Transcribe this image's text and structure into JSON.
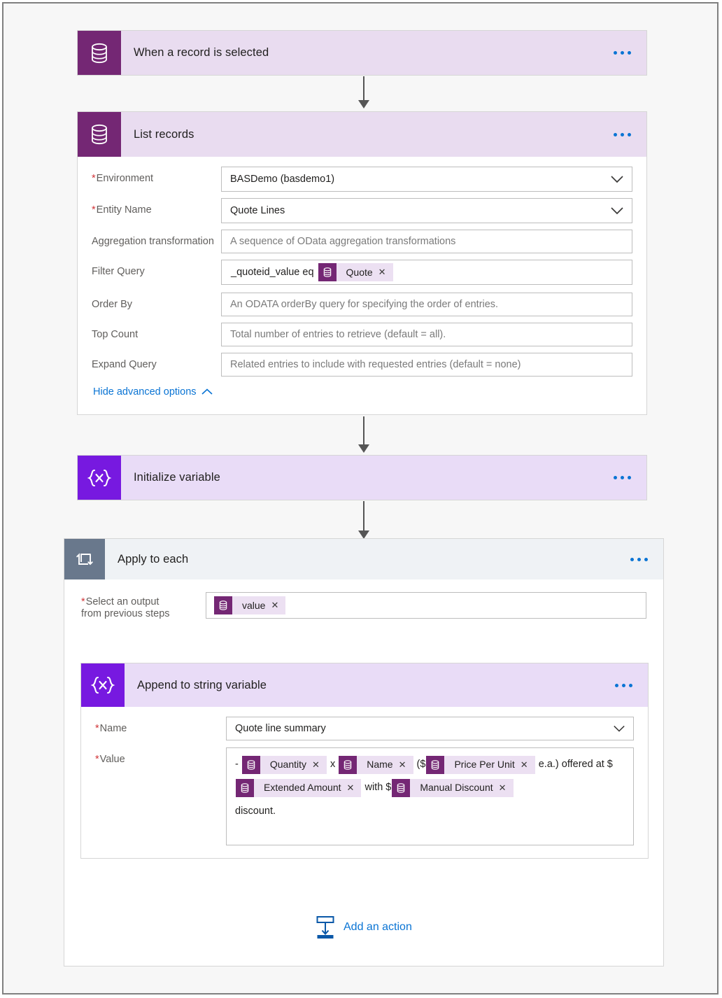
{
  "flow": {
    "steps": [
      {
        "id": "trigger",
        "title": "When a record is selected",
        "icon": "cds-database-icon",
        "menu": "more-options"
      },
      {
        "id": "list-records",
        "title": "List records",
        "icon": "cds-database-icon",
        "menu": "more-options",
        "fields": [
          {
            "label": "Environment",
            "required": true,
            "type": "dropdown",
            "value": "BASDemo (basdemo1)",
            "placeholder": ""
          },
          {
            "label": "Entity Name",
            "required": true,
            "type": "dropdown",
            "value": "Quote Lines",
            "placeholder": ""
          },
          {
            "label": "Aggregation transformation",
            "required": false,
            "type": "text",
            "value": "",
            "placeholder": "A sequence of OData aggregation transformations"
          },
          {
            "label": "Filter Query",
            "required": false,
            "type": "tokenized",
            "prefix": "_quoteid_value eq",
            "token": "Quote",
            "placeholder": ""
          },
          {
            "label": "Order By",
            "required": false,
            "type": "text",
            "value": "",
            "placeholder": "An ODATA orderBy query for specifying the order of entries."
          },
          {
            "label": "Top Count",
            "required": false,
            "type": "text",
            "value": "",
            "placeholder": "Total number of entries to retrieve (default = all)."
          },
          {
            "label": "Expand Query",
            "required": false,
            "type": "text",
            "value": "",
            "placeholder": "Related entries to include with requested entries (default = none)"
          }
        ],
        "advanced_link": "Hide advanced options"
      },
      {
        "id": "initialize-variable",
        "title": "Initialize variable",
        "icon": "variables-icon",
        "menu": "more-options"
      },
      {
        "id": "apply-to-each",
        "title": "Apply to each",
        "icon": "foreach-loop-icon",
        "menu": "more-options",
        "select_output": {
          "label_line1": "Select an output",
          "label_line2": "from previous steps",
          "required": true,
          "token": "value"
        },
        "inner_step": {
          "id": "append-to-string-variable",
          "title": "Append to string variable",
          "icon": "variables-icon",
          "menu": "more-options",
          "name_field": {
            "label": "Name",
            "required": true,
            "value": "Quote line summary"
          },
          "value_field": {
            "label": "Value",
            "required": true,
            "parts": [
              {
                "kind": "text",
                "text": "-"
              },
              {
                "kind": "token",
                "text": "Quantity"
              },
              {
                "kind": "text",
                "text": "x"
              },
              {
                "kind": "token",
                "text": "Name"
              },
              {
                "kind": "text",
                "text": "($"
              },
              {
                "kind": "token",
                "text": "Price Per Unit"
              },
              {
                "kind": "text",
                "text": "e.a.)"
              },
              {
                "kind": "text",
                "text": "offered at $"
              },
              {
                "kind": "token",
                "text": "Extended Amount"
              },
              {
                "kind": "text",
                "text": "with $"
              },
              {
                "kind": "token",
                "text": "Manual Discount"
              },
              {
                "kind": "text",
                "text": "discount."
              }
            ]
          }
        },
        "add_action": {
          "label": "Add an action",
          "icon": "insert-step-icon"
        }
      }
    ]
  },
  "colors": {
    "cds_icon": "#742774",
    "cds_header": "#e9dcf0",
    "variables_icon": "#7719e0",
    "variables_header": "#e9dcf7",
    "loop_icon": "#69788c",
    "loop_header": "#eff2f5",
    "accent_link": "#0a74d4",
    "required_asterisk": "#d13438",
    "token_bg": "#ece0f2",
    "connector": "#555555"
  }
}
